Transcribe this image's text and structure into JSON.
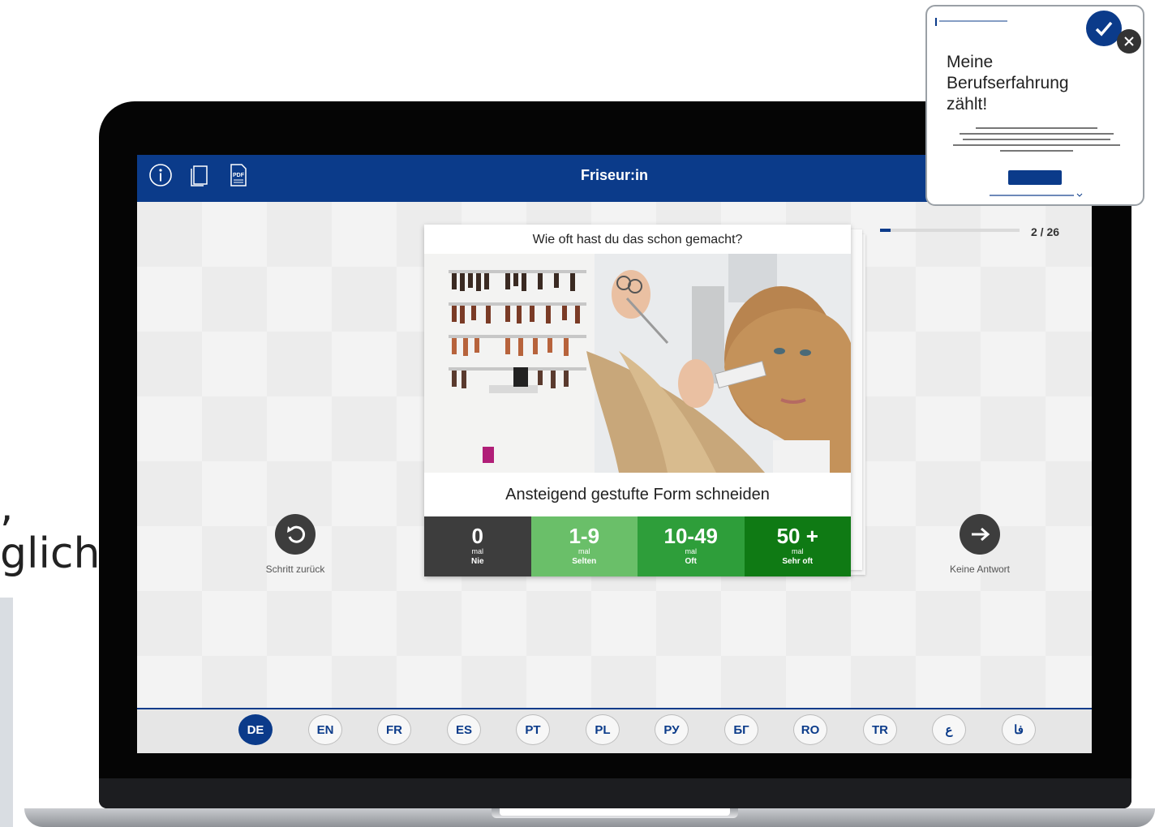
{
  "left_text": {
    "line1": ",",
    "line2": "glich"
  },
  "app": {
    "title": "Friseur:in",
    "icons": [
      "info-icon",
      "pages-icon",
      "pdf-icon"
    ],
    "pdf_icon_label": "PDF"
  },
  "progress": {
    "current": 2,
    "total": 26,
    "label": "2 / 26"
  },
  "card": {
    "question": "Wie oft hast du das schon gemacht?",
    "task": "Ansteigend gestufte Form schneiden",
    "answers": [
      {
        "num": "0",
        "mal": "mal",
        "label": "Nie",
        "color": "#3d3d3d"
      },
      {
        "num": "1-9",
        "mal": "mal",
        "label": "Selten",
        "color": "#6abf69"
      },
      {
        "num": "10-49",
        "mal": "mal",
        "label": "Oft",
        "color": "#2e9e3a"
      },
      {
        "num": "50 +",
        "mal": "mal",
        "label": "Sehr oft",
        "color": "#0f7a14"
      }
    ]
  },
  "nav": {
    "back_label": "Schritt zurück",
    "next_label": "Keine Antwort"
  },
  "languages": [
    {
      "code": "DE",
      "active": true
    },
    {
      "code": "EN",
      "active": false
    },
    {
      "code": "FR",
      "active": false
    },
    {
      "code": "ES",
      "active": false
    },
    {
      "code": "PT",
      "active": false
    },
    {
      "code": "PL",
      "active": false
    },
    {
      "code": "РУ",
      "active": false
    },
    {
      "code": "БГ",
      "active": false
    },
    {
      "code": "RO",
      "active": false
    },
    {
      "code": "TR",
      "active": false
    },
    {
      "code": "ع",
      "active": false
    },
    {
      "code": "فا",
      "active": false
    }
  ],
  "popup": {
    "headline_l1": "Meine",
    "headline_l2": "Berufserfahrung",
    "headline_l3": "zählt!"
  },
  "colors": {
    "brand_blue": "#0b3b8a"
  }
}
